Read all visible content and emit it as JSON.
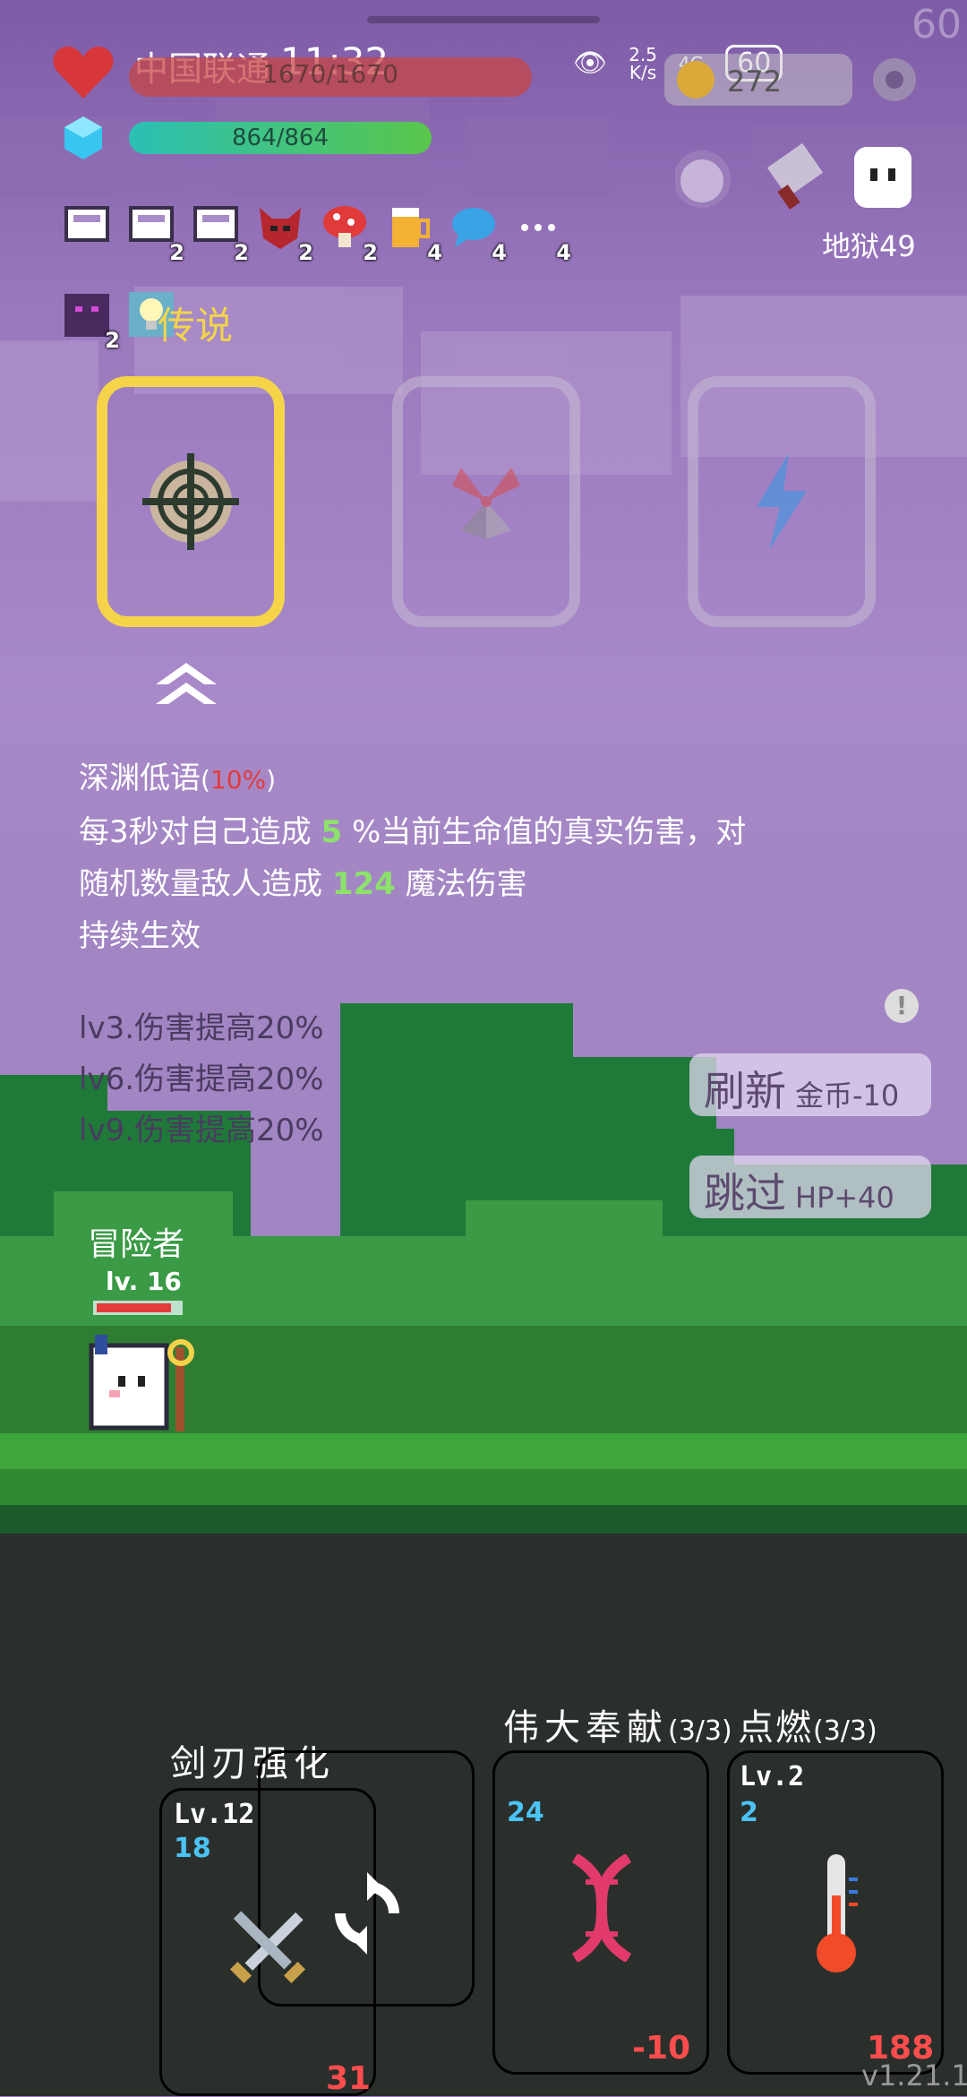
{
  "status_bar": {
    "carrier": "中国联通",
    "time": "11:32",
    "speed_top": "2.5",
    "speed_bottom": "K/s",
    "network": "4G",
    "battery": "60",
    "corner_number": "60"
  },
  "hud": {
    "hp_text": "1670/1670",
    "mp_text": "864/864",
    "coins": "272"
  },
  "top_right": {
    "floor_label": "地狱49"
  },
  "buffs": [
    {
      "icon": "banner-icon",
      "count": ""
    },
    {
      "icon": "banner-icon",
      "count": "2"
    },
    {
      "icon": "banner-icon",
      "count": "2"
    },
    {
      "icon": "demon-mask-icon",
      "count": "2"
    },
    {
      "icon": "mushroom-icon",
      "count": "2"
    },
    {
      "icon": "beer-mug-icon",
      "count": "4"
    },
    {
      "icon": "speech-bubble-icon",
      "count": "4"
    },
    {
      "icon": "more-icon",
      "count": "4"
    }
  ],
  "buffs_row2": [
    {
      "icon": "purple-beast-icon",
      "count": "2"
    },
    {
      "icon": "lightbulb-icon",
      "count": ""
    }
  ],
  "legend_label": "传说",
  "cards": [
    {
      "name": "crosshair-card",
      "selected": true
    },
    {
      "name": "windmill-card",
      "selected": false
    },
    {
      "name": "lightning-card",
      "selected": false
    }
  ],
  "description": {
    "title": "深渊低语",
    "title_pct": "10%",
    "line1_a": "每3秒对自己造成",
    "line1_num": "5",
    "line1_b": "%当前生命值的真实伤害，对",
    "line2_a": "随机数量敌人造成",
    "line2_num": "124",
    "line2_b": "魔法伤害",
    "line3": "持续生效"
  },
  "levels": [
    "lv3.伤害提高20%",
    "lv6.伤害提高20%",
    "lv9.伤害提高20%"
  ],
  "buttons": {
    "refresh_main": "刷新",
    "refresh_cost": "金币-10",
    "skip_main": "跳过",
    "skip_bonus": "HP+40"
  },
  "player": {
    "name": "冒险者",
    "level": "lv. 16",
    "hp_fraction": 0.9
  },
  "skills": {
    "blade_title": "剑刃强化",
    "blade_level": "Lv.12",
    "blade_num": "18",
    "blade_bottom": "31",
    "devotion_title": "伟大奉献",
    "devotion_count": "(3/3)",
    "devotion_num": "24",
    "devotion_bottom": "-10",
    "ignite_title": "点燃",
    "ignite_count": "(3/3)",
    "ignite_level": "Lv.2",
    "ignite_num": "2",
    "ignite_bottom": "188"
  },
  "version": "v1.21.1"
}
